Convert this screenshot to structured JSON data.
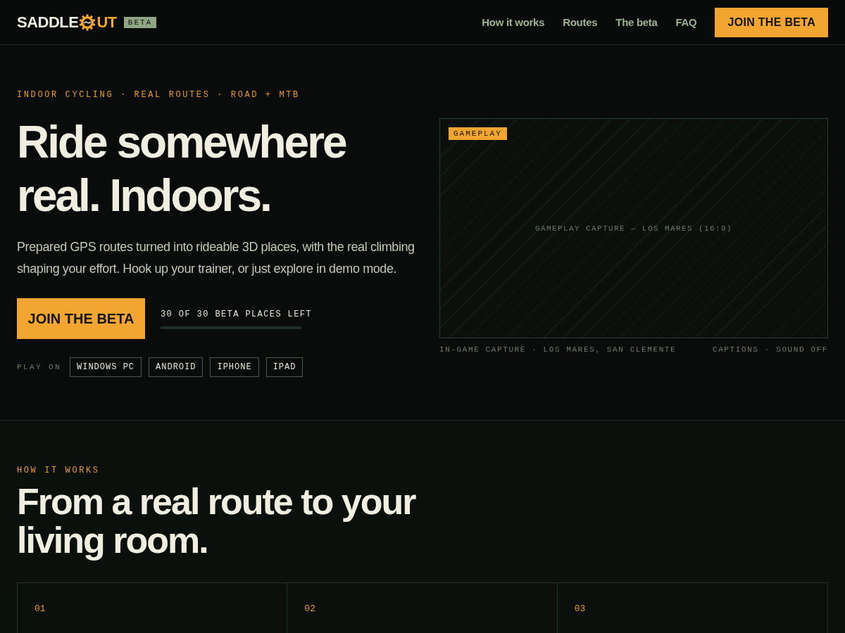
{
  "header": {
    "logo": {
      "left": "SADDLE",
      "right": "UT"
    },
    "badge": "BETA",
    "nav": [
      "How it works",
      "Routes",
      "The beta",
      "FAQ"
    ],
    "cta": "JOIN THE BETA"
  },
  "hero": {
    "eyebrow": "INDOOR CYCLING · REAL ROUTES · ROAD + MTB",
    "title_lines": [
      "Ride somewhere",
      "real. Indoors."
    ],
    "lead": "Prepared GPS routes turned into rideable 3D places, with the real climbing shaping your effort. Hook up your trainer, or just explore in demo mode.",
    "cta": "JOIN THE BETA",
    "places": {
      "label": "30 OF 30 BETA PLACES LEFT",
      "level": 1
    },
    "platforms_label": "PLAY ON",
    "platforms": [
      "WINDOWS PC",
      "ANDROID",
      "IPHONE",
      "IPAD"
    ],
    "video": {
      "tag": "GAMEPLAY",
      "placeholder": "GAMEPLAY CAPTURE — LOS MARES (16:9)",
      "caption_left": "IN-GAME CAPTURE · LOS MARES, SAN CLEMENTE",
      "caption_right": "CAPTIONS · SOUND OFF"
    }
  },
  "how": {
    "eyebrow": "HOW IT WORKS",
    "title": "From a real route to your living room.",
    "steps": [
      {
        "number": "01"
      },
      {
        "number": "02"
      },
      {
        "number": "03"
      }
    ]
  }
}
